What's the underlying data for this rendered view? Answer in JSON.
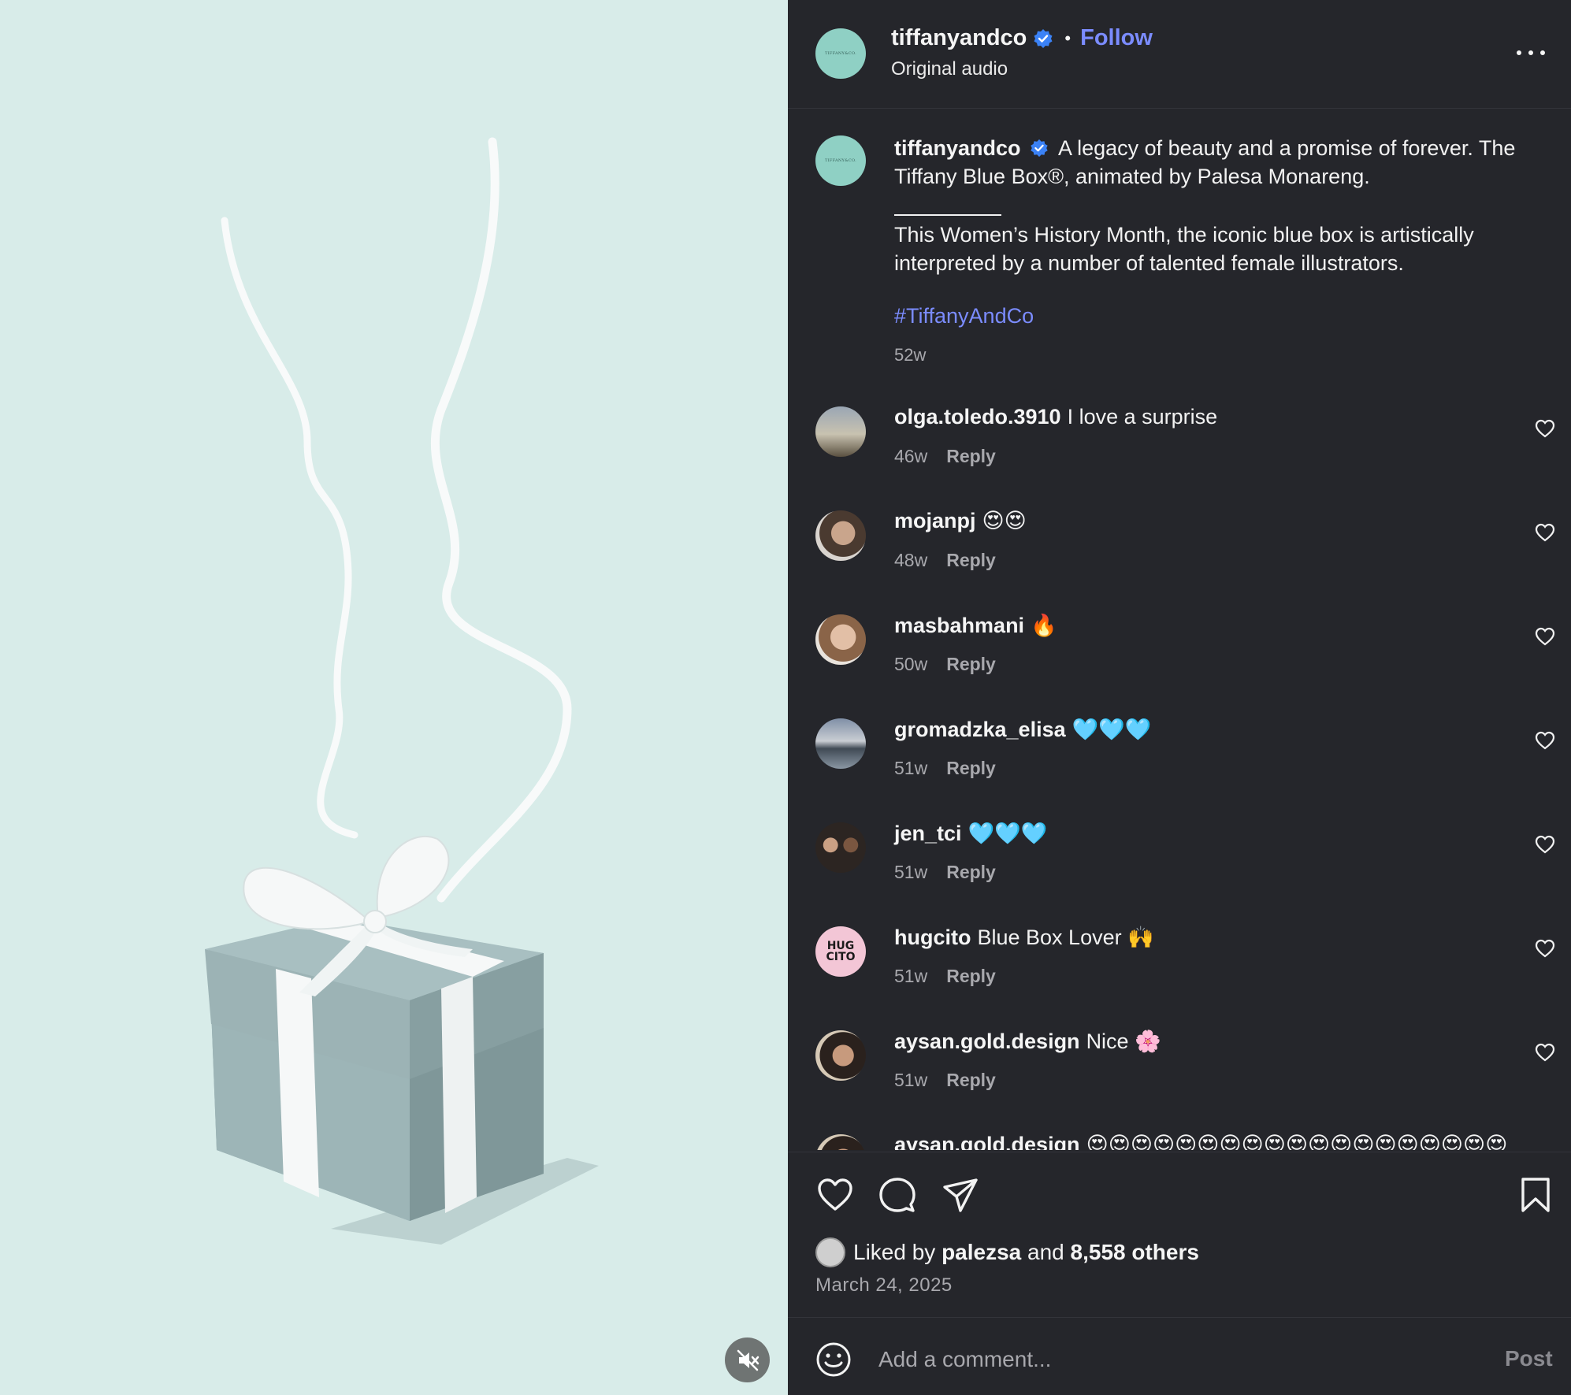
{
  "post": {
    "username": "tiffanyandco",
    "follow_label": "Follow",
    "audio_label": "Original audio",
    "avatar_text": "TIFFANY&CO."
  },
  "caption": {
    "username": "tiffanyandco",
    "text": "A legacy of beauty and a promise of forever. The Tiffany Blue Box®, animated by Palesa Monareng.",
    "text2": "This Women’s History Month, the iconic blue box is artistically interpreted by a number of talented female illustrators.",
    "hashtag": "#TiffanyAndCo",
    "time": "52w"
  },
  "comments": [
    {
      "user": "olga.toledo.3910",
      "text": "I love a surprise",
      "time": "46w",
      "reply_label": "Reply"
    },
    {
      "user": "mojanpj",
      "text": "😍😍",
      "time": "48w",
      "reply_label": "Reply"
    },
    {
      "user": "masbahmani",
      "text": "🔥",
      "time": "50w",
      "reply_label": "Reply"
    },
    {
      "user": "gromadzka_elisa",
      "text": "🩵🩵🩵",
      "time": "51w",
      "reply_label": "Reply"
    },
    {
      "user": "jen_tci",
      "text": "🩵🩵🩵",
      "time": "51w",
      "reply_label": "Reply"
    },
    {
      "user": "hugcito",
      "text": "Blue Box Lover 🙌",
      "time": "51w",
      "reply_label": "Reply"
    },
    {
      "user": "aysan.gold.design",
      "text": "Nice 🌸",
      "time": "51w",
      "reply_label": "Reply"
    },
    {
      "user": "aysan.gold.design",
      "text": "😍😍😍😍😍😍😍😍😍😍😍😍😍😍😍😍😍😍😍",
      "time": "",
      "reply_label": ""
    }
  ],
  "likes": {
    "prefix": "Liked by",
    "user": "palezsa",
    "conj": "and",
    "others": "8,558 others"
  },
  "date": "March 24, 2025",
  "composer": {
    "placeholder": "Add a comment...",
    "post_label": "Post"
  },
  "hugcito_avatar_text": "HUG CITO",
  "colors": {
    "background": "#25262b",
    "media_background": "#d8ece9",
    "accent": "#7b8cff",
    "muted_text": "#a8a8ad",
    "verified": "#3b82f6",
    "tiffany_blue": "#8fd0c4"
  },
  "icons": [
    "verified-badge-icon",
    "more-options-icon",
    "heart-icon",
    "comment-icon",
    "share-icon",
    "bookmark-icon",
    "emoji-icon",
    "mute-icon"
  ]
}
